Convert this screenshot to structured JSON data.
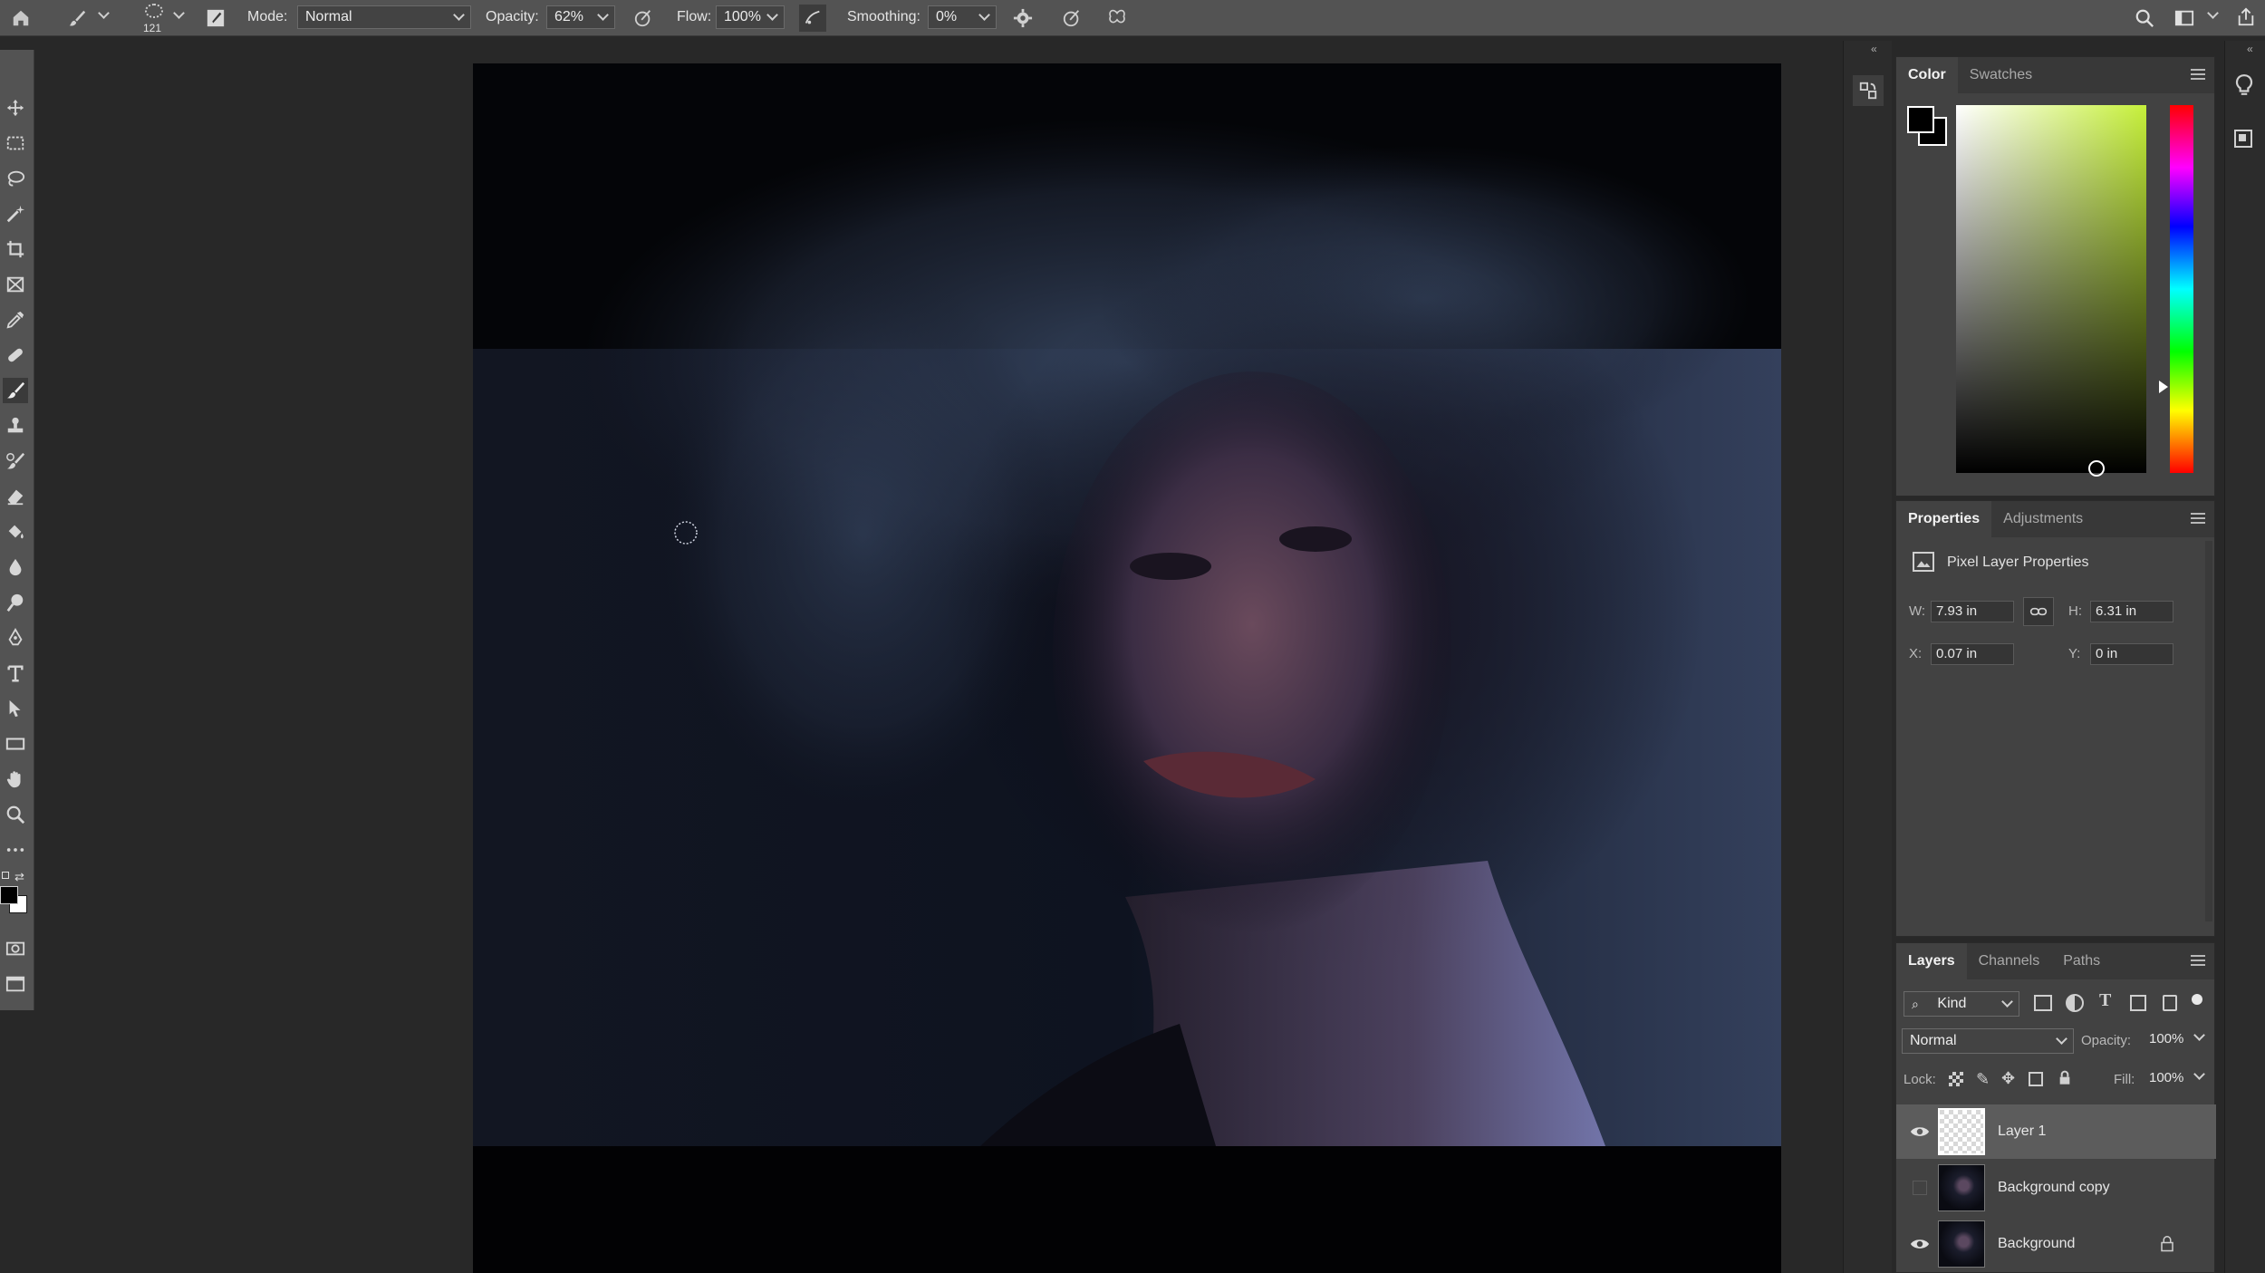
{
  "options_bar": {
    "brush_size": "121",
    "mode_label": "Mode:",
    "mode_value": "Normal",
    "opacity_label": "Opacity:",
    "opacity_value": "62%",
    "flow_label": "Flow:",
    "flow_value": "100%",
    "smoothing_label": "Smoothing:",
    "smoothing_value": "0%"
  },
  "color_panel": {
    "tabs": [
      "Color",
      "Swatches"
    ],
    "active_tab": "Color",
    "foreground": "#000000",
    "background": "#ffffff",
    "hue_color": "#c6f03a"
  },
  "properties_panel": {
    "tabs": [
      "Properties",
      "Adjustments"
    ],
    "title": "Pixel Layer Properties",
    "w_label": "W:",
    "w_value": "7.93 in",
    "h_label": "H:",
    "h_value": "6.31 in",
    "x_label": "X:",
    "x_value": "0.07 in",
    "y_label": "Y:",
    "y_value": "0 in"
  },
  "layers_panel": {
    "tabs": [
      "Layers",
      "Channels",
      "Paths"
    ],
    "filter_value": "Kind",
    "blend_mode": "Normal",
    "opacity_label": "Opacity:",
    "opacity_value": "100%",
    "lock_label": "Lock:",
    "fill_label": "Fill:",
    "fill_value": "100%",
    "layers": [
      {
        "name": "Layer 1",
        "visible": true,
        "selected": true,
        "locked": false
      },
      {
        "name": "Background copy",
        "visible": false,
        "selected": false,
        "locked": false
      },
      {
        "name": "Background",
        "visible": true,
        "selected": false,
        "locked": true
      }
    ]
  }
}
